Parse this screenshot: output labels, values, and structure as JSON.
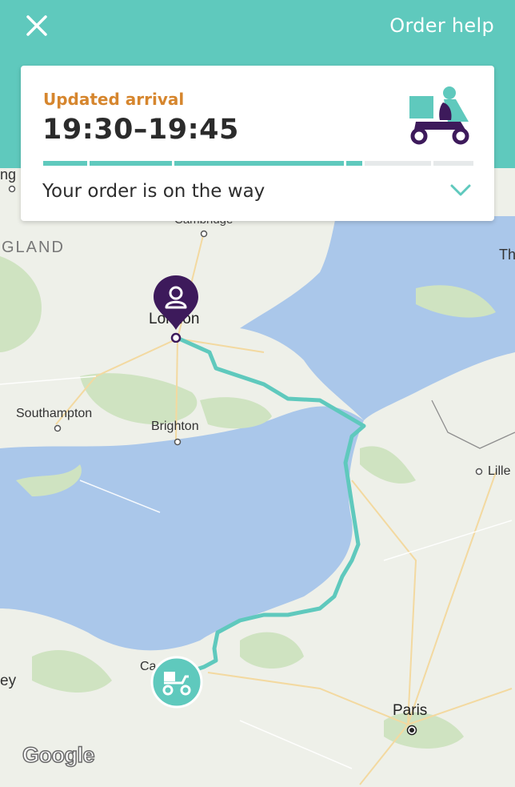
{
  "header": {
    "order_help_label": "Order help"
  },
  "card": {
    "arrival_label": "Updated arrival",
    "arrival_time": "19:30–19:45",
    "status_text": "Your order is on the way"
  },
  "map": {
    "labels": {
      "top_left_partial": "ing",
      "cambridge_partial": "Cambridge",
      "england_partial": "GLAND",
      "th_partial": "Th",
      "london": "London",
      "southampton": "Southampton",
      "brighton": "Brighton",
      "lille": "Lille",
      "ey_partial": "ey",
      "ca_partial": "Ca",
      "paris": "Paris"
    },
    "attribution": "Google"
  },
  "colors": {
    "brand_teal": "#5fc9bd",
    "accent_orange": "#d6862e",
    "pin_purple": "#3d1a5b",
    "sea": "#aadaff"
  }
}
